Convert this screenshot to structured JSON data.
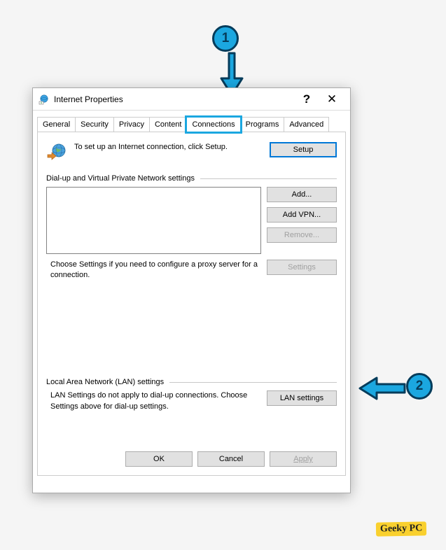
{
  "window": {
    "title": "Internet Properties",
    "help": "?",
    "close": "✕"
  },
  "tabs": {
    "general": "General",
    "security": "Security",
    "privacy": "Privacy",
    "content": "Content",
    "connections": "Connections",
    "programs": "Programs",
    "advanced": "Advanced"
  },
  "setup": {
    "text": "To set up an Internet connection, click Setup.",
    "button": "Setup"
  },
  "dialup": {
    "legend": "Dial-up and Virtual Private Network settings",
    "add": "Add...",
    "addvpn": "Add VPN...",
    "remove": "Remove...",
    "proxy_text": "Choose Settings if you need to configure a proxy server for a connection.",
    "settings": "Settings"
  },
  "lan": {
    "legend": "Local Area Network (LAN) settings",
    "text": "LAN Settings do not apply to dial-up connections. Choose Settings above for dial-up settings.",
    "button": "LAN settings"
  },
  "footer": {
    "ok": "OK",
    "cancel": "Cancel",
    "apply": "Apply"
  },
  "annotations": {
    "step1": "1",
    "step2": "2"
  },
  "watermark": "Geeky PC"
}
